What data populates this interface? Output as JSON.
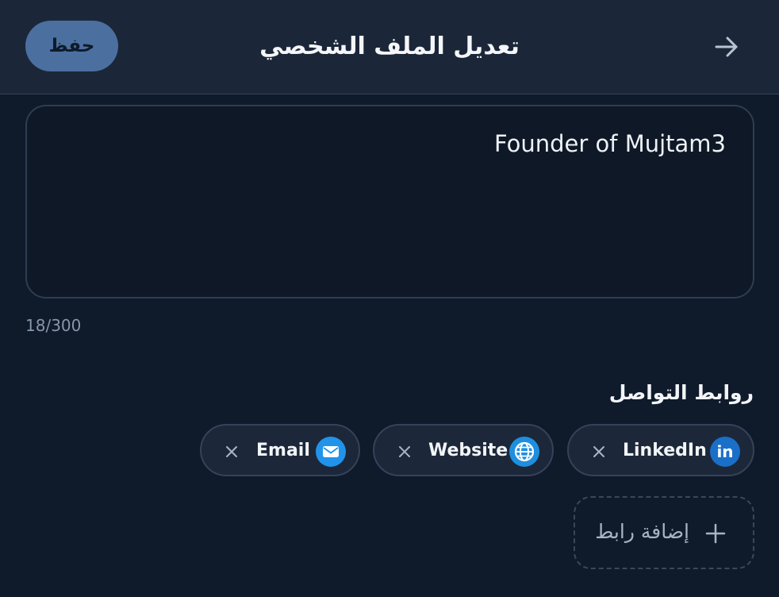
{
  "header": {
    "title": "تعديل الملف الشخصي",
    "save_label": "حفظ",
    "back_icon": "arrow-right-icon"
  },
  "bio": {
    "value": "Founder of Mujtam3",
    "char_count": "18/300"
  },
  "links_section": {
    "title": "روابط التواصل",
    "chips": [
      {
        "label": "LinkedIn",
        "icon": "linkedin-icon",
        "color": "#1a6fc9"
      },
      {
        "label": "Website",
        "icon": "globe-icon",
        "color": "#1e8fe0"
      },
      {
        "label": "Email",
        "icon": "mail-icon",
        "color": "#2293ea"
      }
    ],
    "add_label": "إضافة رابط"
  },
  "colors": {
    "background": "#0f1a2a",
    "header": "#1b2738",
    "save_button": "#4b6f9f"
  }
}
